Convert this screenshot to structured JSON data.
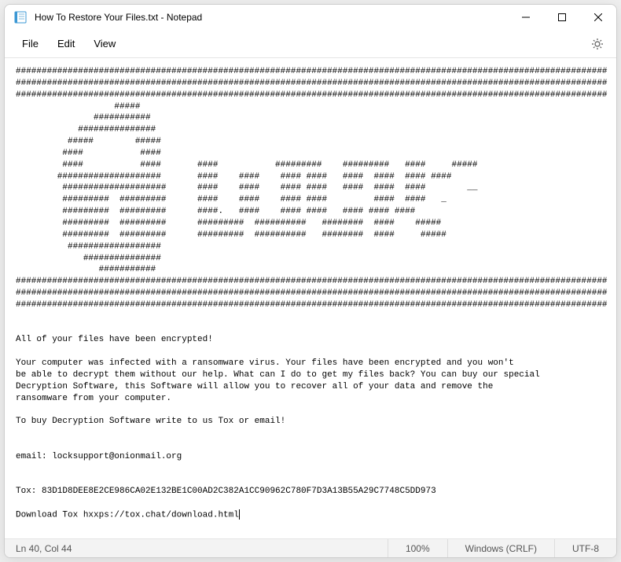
{
  "window": {
    "title": "How To Restore Your Files.txt - Notepad"
  },
  "menu": {
    "file": "File",
    "edit": "Edit",
    "view": "View"
  },
  "document": {
    "text": "##################################################################################################################\n##################################################################################################################\n##################################################################################################################\n                   #####\n               ###########\n            ###############\n          #####        #####\n         ####           ####\n         ####           ####       ####           #########    #########   ####     #####\n        ####################       ####    ####    #### ####   ####  ####  #### ####\n         ####################      ####    ####    #### ####   ####  ####  ####        __\n         #########  #########      ####    ####    #### ####         ####  ####   _\n         #########  #########      ####.   ####    #### ####   #### #### ####\n         #########  #########      #########  ##########   ########  ####    #####\n         #########  #########      #########  ##########   ########  ####     #####\n          ##################\n             ###############\n                ###########\n##################################################################################################################\n##################################################################################################################\n##################################################################################################################\n\n\nAll of your files have been encrypted!\n\nYour computer was infected with a ransomware virus. Your files have been encrypted and you won't\nbe able to decrypt them without our help. What can I do to get my files back? You can buy our special\nDecryption Software, this Software will allow you to recover all of your data and remove the\nransomware from your computer.\n\nTo buy Decryption Software write to us Tox or email!\n\n\nemail: locksupport@onionmail.org\n\n\nTox: 83D1D8DEE8E2CE986CA02E132BE1C00AD2C382A1CC90962C780F7D3A13B55A29C7748C5DD973\n\nDownload Tox hxxps://tox.chat/download.html"
  },
  "status": {
    "position": "Ln 40, Col 44",
    "zoom": "100%",
    "lineending": "Windows (CRLF)",
    "encoding": "UTF-8"
  }
}
